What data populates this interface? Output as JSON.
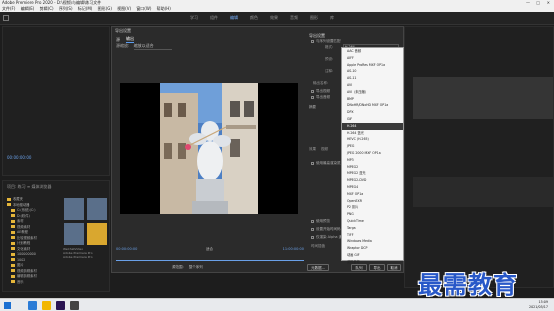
{
  "window": {
    "title": "Adobe Premiere Pro 2020 - D:\\视频\\与编辑\\练习文件",
    "controls": [
      "—",
      "□",
      "✕"
    ]
  },
  "menubar": [
    "文件(F)",
    "编辑(E)",
    "剪辑(C)",
    "序列(S)",
    "标记(M)",
    "图形(G)",
    "视图(V)",
    "窗口(W)",
    "帮助(H)"
  ],
  "workspace_tabs": [
    {
      "label": "学习",
      "active": false
    },
    {
      "label": "组件",
      "active": false
    },
    {
      "label": "编辑",
      "active": true
    },
    {
      "label": "颜色",
      "active": false
    },
    {
      "label": "效果",
      "active": false
    },
    {
      "label": "音频",
      "active": false
    },
    {
      "label": "图形",
      "active": false
    },
    {
      "label": "库",
      "active": false
    }
  ],
  "left_panel": {
    "timecode": "00:00:00:00"
  },
  "project_panel": {
    "tabs": "项目: 练习 ≡   媒体浏览器",
    "tree": [
      "收藏夹",
      "本地驱动器",
      "C:(系统)(C:)",
      "D:(软件)",
      "素材",
      "视频素材",
      "AE教程",
      "比较视频素材",
      "计划教程",
      "文化素材",
      "100000000",
      "1002",
      "图片",
      "视频剪辑素材",
      "编辑剪辑素材",
      "音乐"
    ],
    "thumb_captions": [
      "WeChatVideo",
      "Adobe Premiere Pro",
      "Adobe Premiere Pro"
    ]
  },
  "export_dialog": {
    "title": "导出设置",
    "tabs": [
      {
        "label": "源",
        "active": false
      },
      {
        "label": "输出",
        "active": true
      }
    ],
    "source_scale_label": "源缩放:",
    "source_scale_value": "缩放以适合",
    "timecode_start": "00:00:00:00",
    "timecode_end": "11:00:00:00",
    "fit_label": "适合",
    "source_range_label": "源范围:",
    "source_range_value": "整个序列",
    "settings": {
      "header": "导出设置",
      "match_label": "与序列设置匹配",
      "format_label": "格式:",
      "format_value": "H.264",
      "preset_label": "预设:",
      "comments_label": "注释:",
      "output_name_label": "输出名称:",
      "export_video": "导出视频",
      "export_audio": "导出音频",
      "summary_label": "摘要",
      "effects_tab": "效果",
      "video_tab": "视频",
      "max_render_label": "使用最高渲染质量",
      "use_previews_label": "使用预览",
      "set_start_timecode": "设置开始时间码",
      "render_alpha_label": "仅渲染 Alpha 通道",
      "time_interpolation_label": "时间插值",
      "frame_sampling_value": "帧采样",
      "queue_button": "队列",
      "export_button": "导出",
      "cancel_button": "取消",
      "metadata_button": "元数据..."
    },
    "bottom_left_button": "元数据..."
  },
  "format_list": [
    "AAC 音频",
    "AIFF",
    "Apple ProRes MXF OP1a",
    "AS-10",
    "AS-11",
    "AVI",
    "AVI（未压缩）",
    "BMP",
    "DNxHR/DNxHD MXF OP1a",
    "DPX",
    "GIF",
    "H.264",
    "H.264 蓝光",
    "HEVC (H.265)",
    "JPEG",
    "JPEG 2000 MXF OP1a",
    "MP3",
    "MPEG2",
    "MPEG2 蓝光",
    "MPEG2-DVD",
    "MPEG4",
    "MXF OP1a",
    "OpenEXR",
    "P2 影片",
    "PNG",
    "QuickTime",
    "Targa",
    "TIFF",
    "Windows Media",
    "Wraptor DCP",
    "动画 GIF",
    "波形音频"
  ],
  "format_list_selected": "H.264",
  "watermark": "最需教育",
  "taskbar": {
    "time": "15:09",
    "date": "2021/05/17"
  }
}
